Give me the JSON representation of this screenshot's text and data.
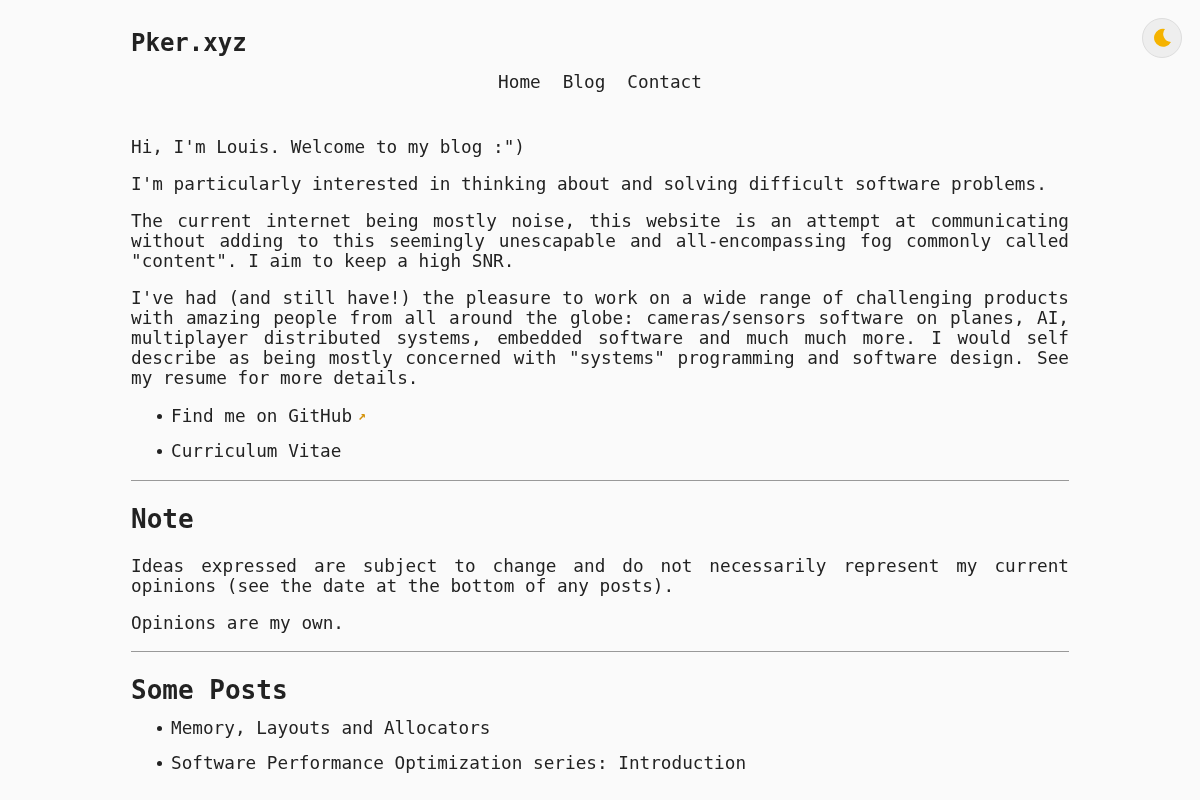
{
  "site_title": "Pker.xyz",
  "theme_toggle": {
    "dark": false
  },
  "nav": [
    {
      "label": "Home"
    },
    {
      "label": "Blog"
    },
    {
      "label": "Contact"
    }
  ],
  "intro": [
    "Hi, I'm Louis. Welcome to my blog :\")",
    "I'm particularly interested in thinking about and solving difficult software problems.",
    "The current internet being mostly noise, this website is an attempt at communicating without adding to this seemingly unescapable and all-encompassing fog commonly called \"content\". I aim to keep a high SNR.",
    "I've had (and still have!) the pleasure to work on a wide range of challenging products with amazing people from all around the globe: cameras/sensors software on planes, AI, multiplayer distributed systems, embedded software and much much more. I would self describe as being mostly concerned with \"systems\" programming and software design. See my resume for more details."
  ],
  "links": [
    {
      "label": "Find me on GitHub",
      "external_mark": "↗"
    },
    {
      "label": "Curriculum Vitae"
    }
  ],
  "note": {
    "heading": "Note",
    "paragraphs": [
      "Ideas expressed are subject to change and do not necessarily represent my current opinions (see the date at the bottom of any posts).",
      "Opinions are my own."
    ]
  },
  "posts": {
    "heading": "Some Posts",
    "items": [
      "Memory, Layouts and Allocators",
      "Software Performance Optimization series: Introduction"
    ]
  }
}
